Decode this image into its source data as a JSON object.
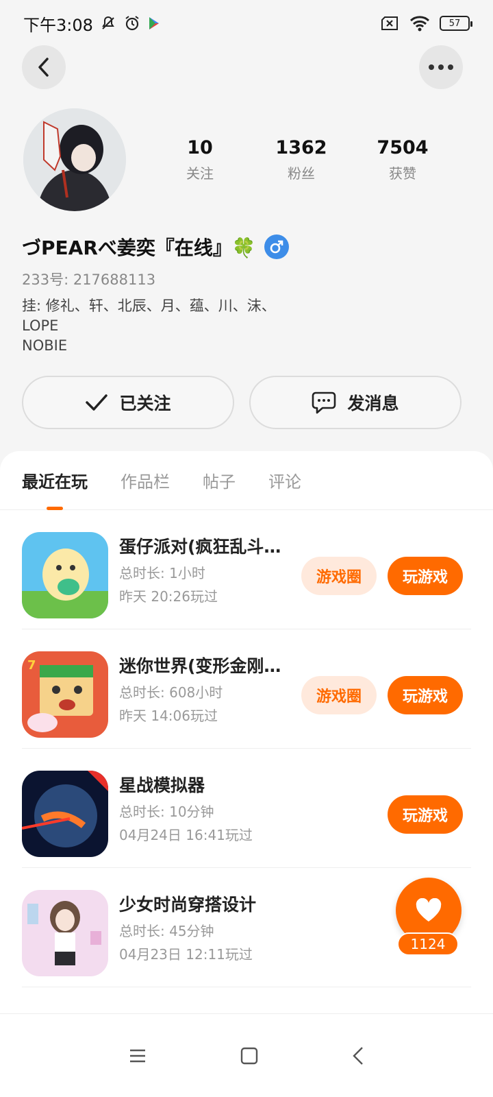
{
  "status_bar": {
    "time": "下午3:08",
    "battery": "57"
  },
  "profile": {
    "username": "づPEARべ姜奕『在线』🍀",
    "gender_symbol": "♂",
    "uid": "233号: 217688113",
    "bio_lines": [
      "挂: 修礼、轩、北辰、月、蕴、川、沫、",
      "LOPE",
      "NOBIE"
    ],
    "stats": [
      {
        "value": "10",
        "label": "关注"
      },
      {
        "value": "1362",
        "label": "粉丝"
      },
      {
        "value": "7504",
        "label": "获赞"
      }
    ]
  },
  "actions": {
    "follow_label": "已关注",
    "message_label": "发消息"
  },
  "tabs": [
    "最近在玩",
    "作品栏",
    "帖子",
    "评论"
  ],
  "games": [
    {
      "name": "蛋仔派对(疯狂乱斗…",
      "duration": "总时长: 1小时",
      "last_played": "昨天 20:26玩过",
      "circle_label": "游戏圈",
      "play_label": "玩游戏"
    },
    {
      "name": "迷你世界(变形金刚…",
      "duration": "总时长: 608小时",
      "last_played": "昨天 14:06玩过",
      "circle_label": "游戏圈",
      "play_label": "玩游戏"
    },
    {
      "name": "星战模拟器",
      "duration": "总时长: 10分钟",
      "last_played": "04月24日 16:41玩过",
      "play_label": "玩游戏"
    },
    {
      "name": "少女时尚穿搭设计",
      "duration": "总时长: 45分钟",
      "last_played": "04月23日 12:11玩过"
    }
  ],
  "like_fab": {
    "count": "1124"
  },
  "colors": {
    "accent": "#ff6a00",
    "accent_light": "#ffe9dc"
  }
}
